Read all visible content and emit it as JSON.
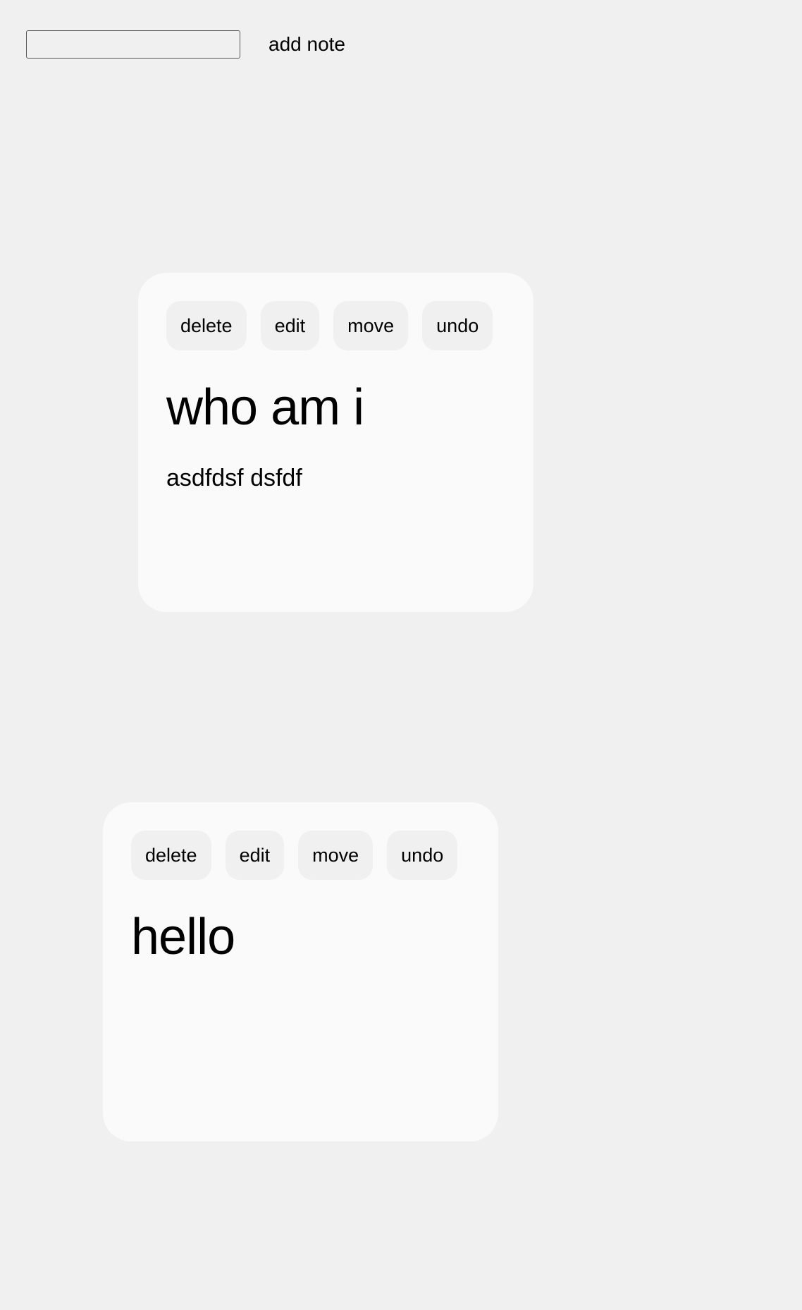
{
  "toolbar": {
    "input_value": "",
    "input_placeholder": "",
    "add_label": "add note"
  },
  "notes": [
    {
      "actions": {
        "delete": "delete",
        "edit": "edit",
        "move": "move",
        "undo": "undo"
      },
      "title": "who am i",
      "body": "asdfdsf dsfdf"
    },
    {
      "actions": {
        "delete": "delete",
        "edit": "edit",
        "move": "move",
        "undo": "undo"
      },
      "title": "hello",
      "body": ""
    }
  ]
}
